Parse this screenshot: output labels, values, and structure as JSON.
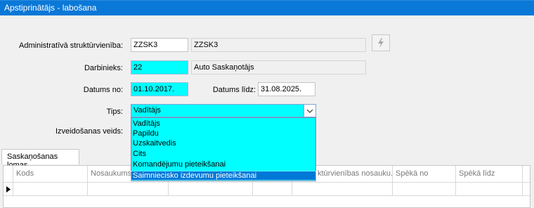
{
  "window": {
    "title": "Apstiprinātājs - labošana"
  },
  "form": {
    "admin_unit_label": "Administratīvā struktūrvienība:",
    "admin_unit_code": "ZZSK3",
    "admin_unit_name": "ZZSK3",
    "employee_label": "Darbinieks:",
    "employee_code": "22",
    "employee_name": "Auto Saskaņotājs",
    "date_from_label": "Datums no:",
    "date_from": "01.10.2017.",
    "date_to_label": "Datums līdz:",
    "date_to": "31.08.2025.",
    "type_label": "Tips:",
    "type_value": "Vadītājs",
    "creation_label": "Izveidošanas veids:"
  },
  "type_options": [
    "Vadītājs",
    "Papildu",
    "Uzskaitvedis",
    "Cits",
    "Komandējumu pieteikšanai",
    "Saimniecisko izdevumu pieteikšanai"
  ],
  "tab": {
    "label": "Saskaņošanas lomas"
  },
  "grid": {
    "columns": [
      "Kods",
      "Nosaukums",
      "",
      "",
      "ktūrvienības nosauku...",
      "Spēkā no",
      "Spēkā līdz"
    ]
  },
  "icons": {
    "flash": "lightning-icon",
    "dropdown": "chevron-down-icon",
    "row_pointer": "row-pointer-icon"
  },
  "colors": {
    "titlebar": "#0a78d7",
    "highlight": "#00ffff",
    "selection": "#0078d7"
  }
}
